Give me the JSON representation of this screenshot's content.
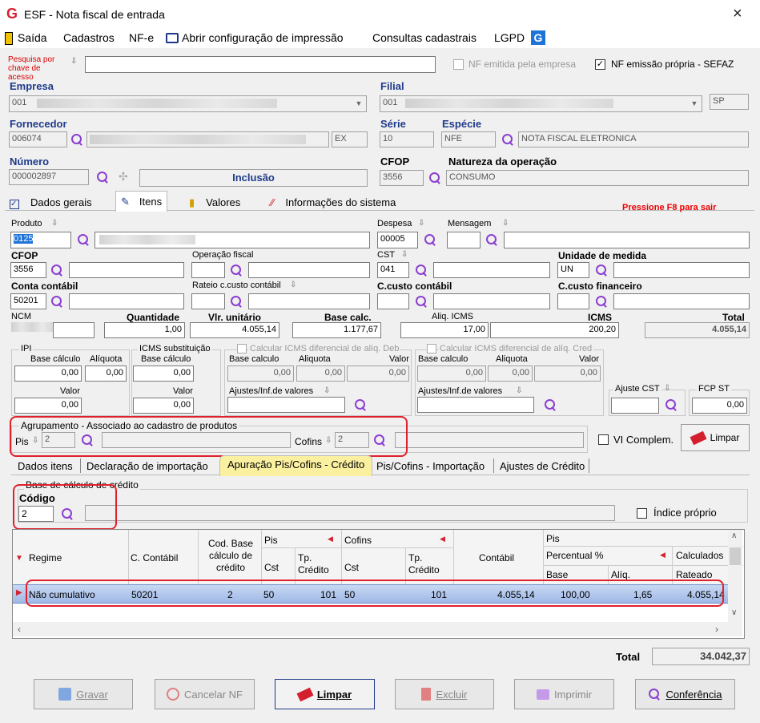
{
  "window": {
    "title": "ESF - Nota fiscal de entrada",
    "close": "×"
  },
  "menu": {
    "items": [
      "Saída",
      "Cadastros",
      "NF-e",
      "Abrir configuração de impressão",
      "Consultas cadastrais",
      "LGPD"
    ]
  },
  "search": {
    "label": "Pesquisa por chave de acesso",
    "value": "",
    "nf_emitida_label": "NF emitida pela empresa",
    "nf_propria_label": "NF emissão própria - SEFAZ",
    "nf_propria_checked": true
  },
  "header": {
    "empresa_label": "Empresa",
    "empresa_value": "001",
    "filial_label": "Filial",
    "filial_value": "001",
    "uf": "SP",
    "fornecedor_label": "Fornecedor",
    "fornecedor_code": "006074",
    "fornecedor_suffix": "EX",
    "serie_label": "Série",
    "serie_value": "10",
    "especie_label": "Espécie",
    "especie_code": "NFE",
    "especie_desc": "NOTA FISCAL ELETRONICA",
    "numero_label": "Número",
    "numero_value": "000002897",
    "mode": "Inclusão",
    "cfop_label": "CFOP",
    "cfop_value": "3556",
    "natureza_label": "Natureza da operação",
    "natureza_value": "CONSUMO"
  },
  "tabs": [
    "Dados gerais",
    "Itens",
    "Valores",
    "Informações do sistema"
  ],
  "hint": "Pressione F8 para sair",
  "item": {
    "produto_label": "Produto",
    "produto_value": "0125",
    "despesa_label": "Despesa",
    "despesa_value": "00005",
    "mensagem_label": "Mensagem",
    "cfop_label": "CFOP",
    "cfop_value": "3556",
    "operacao_label": "Operação fiscal",
    "cst_label": "CST",
    "cst_value": "041",
    "unidade_label": "Unidade de medida",
    "unidade_value": "UN",
    "conta_label": "Conta contábil",
    "conta_value": "50201",
    "rateio_label": "Rateio c.custo contábil",
    "ccusto_label": "C.custo contábil",
    "ccusto_fin_label": "C.custo financeiro",
    "ncm_label": "NCM",
    "qtd_label": "Quantidade",
    "qtd_value": "1,00",
    "vlr_label": "Vlr. unitário",
    "vlr_value": "4.055,14",
    "base_label": "Base calc.",
    "base_value": "1.177,67",
    "aliq_label": "Aliq. ICMS",
    "aliq_value": "17,00",
    "icms_label": "ICMS",
    "icms_value": "200,20",
    "total_label": "Total",
    "total_value": "4.055,14"
  },
  "taxes": {
    "ipi_title": "IPI",
    "ipi_base_label": "Base cálculo",
    "ipi_base": "0,00",
    "ipi_aliq_label": "Alíquota",
    "ipi_aliq": "0,00",
    "ipi_valor_label": "Valor",
    "ipi_valor": "0,00",
    "st_title": "ICMS substituição",
    "st_base_label": "Base cálculo",
    "st_base": "0,00",
    "st_valor_label": "Valor",
    "st_valor": "0,00",
    "deb_title": "Calcular ICMS diferencial de alíq. Deb",
    "deb_base_label": "Base calculo",
    "deb_base": "0,00",
    "deb_aliq_label": "Aliquota",
    "deb_aliq": "0,00",
    "deb_valor_label": "Valor",
    "deb_valor": "0,00",
    "deb_ajuste_label": "Ajustes/Inf.de valores",
    "cred_title": "Calcular ICMS diferencial de alíq. Cred",
    "cred_base_label": "Base calculo",
    "cred_base": "0,00",
    "cred_aliq_label": "Aliquota",
    "cred_aliq": "0,00",
    "cred_valor_label": "Valor",
    "cred_valor": "0,00",
    "cred_ajuste_label": "Ajustes/Inf.de valores",
    "ajuste_cst_label": "Ajuste CST",
    "fcp_label": "FCP ST",
    "fcp_value": "0,00"
  },
  "agrupamento": {
    "title": "Agrupamento - Associado ao cadastro de produtos",
    "pis_label": "Pis",
    "pis_value": "2",
    "cofins_label": "Cofins",
    "cofins_value": "2",
    "vi_label": "VI Complem.",
    "limpar_label": "Limpar"
  },
  "subtabs": [
    "Dados itens",
    "Declaração de importação",
    "Apuração Pis/Cofins - Crédito",
    "Pis/Cofins - Importação",
    "Ajustes de Crédito"
  ],
  "credito": {
    "group_title": "Base de cálculo de crédito",
    "codigo_label": "Código",
    "codigo_value": "2",
    "indice_label": "Índice próprio"
  },
  "grid": {
    "headers": {
      "regime": "Regime",
      "conta": "C. Contábil",
      "cod_base": "Cod. Base cálculo de crédito",
      "pis": "Pis",
      "cofins": "Cofins",
      "cst": "Cst",
      "tp_credito": "Tp. Crédito",
      "contabil": "Contábil",
      "pis2": "Pis",
      "percentual": "Percentual %",
      "calculados": "Calculados",
      "base": "Base",
      "aliq": "Alíq.",
      "rateado": "Rateado"
    },
    "row": {
      "regime": "Não cumulativo",
      "conta": "50201",
      "cod_base": "2",
      "pis_cst": "50",
      "pis_tp": "101",
      "cofins_cst": "50",
      "cofins_tp": "101",
      "contabil": "4.055,14",
      "base": "100,00",
      "aliq": "1,65",
      "rateado": "4.055,14"
    }
  },
  "total": {
    "label": "Total",
    "value": "34.042,37"
  },
  "buttons": {
    "gravar": "Gravar",
    "cancelar": "Cancelar NF",
    "limpar": "Limpar",
    "excluir": "Excluir",
    "imprimir": "Imprimir",
    "conferencia": "Conferência"
  }
}
